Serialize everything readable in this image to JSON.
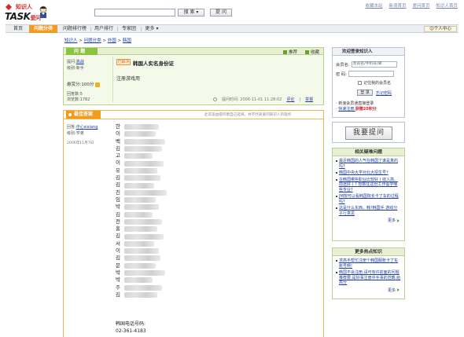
{
  "logo": {
    "top_text": "知识人",
    "main_text": "TASK",
    "sub_text": "爱问"
  },
  "top_links": [
    "收藏本站",
    "新浪首页",
    "爱问首页",
    "知识人首页"
  ],
  "search": {
    "button_label": "搜 索",
    "dropdown_icon": "chevron-down-icon",
    "ask_label": "提 问"
  },
  "nav": {
    "items": [
      "首页",
      "问题分类",
      "问题排行榜",
      "用户排行",
      "专家团",
      "更多"
    ],
    "active_index": 1,
    "user_center": "个人中心"
  },
  "breadcrumb": [
    "知识人",
    "问题分类",
    "外国",
    "韩国"
  ],
  "question": {
    "tab_label": "问 题",
    "actions": [
      "推荐",
      "收藏"
    ],
    "asker_label": "提问:",
    "asker_name": "高战",
    "level_label": "级别:",
    "level_value": "新手",
    "score_label": "悬赏分:",
    "score_value": "100分",
    "answers_label": "回答数:",
    "answers_value": "5",
    "views_label": "浏览数:",
    "views_value": "1782",
    "status_badge": "已解决",
    "title": "韩国人实名身份证",
    "description": "注册游戏用",
    "time_label": "提问时间:",
    "time_value": "2006-11-01 11:28:02",
    "comment_link": "评论",
    "report_link": "举报"
  },
  "note": "此答案由提问者自己选择，并不代表爱问知识人的观点",
  "best_answer": {
    "tab_label": "最佳答案",
    "answerer_label": "回答:",
    "answerer_name": "中心sixiang",
    "level_label": "级别:",
    "level_value": "学弟",
    "date": "2006年11月7日",
    "lines": [
      "한",
      "이",
      "백",
      "김",
      "고",
      "이",
      "유",
      "김",
      "김",
      "진",
      "임",
      "박",
      "김",
      "전",
      "홍",
      "김",
      "서",
      "이",
      "김",
      "문",
      "박",
      "박",
      "주",
      "김"
    ],
    "tail_lines": [
      "韩国电话号码:",
      "02-361-4183"
    ]
  },
  "login": {
    "title": "欢迎登录知识人",
    "member_label": "会员名:",
    "member_placeholder": "会员名/手机号/邮",
    "password_label": "密  码:",
    "remember_label": "记住我的会员名",
    "login_button": "登 录",
    "forgot_link": "忘记密码",
    "tip_1": "新浪会员通直接登录",
    "tip_2_link": "快速注册,",
    "tip_2_red": "获赠20积分"
  },
  "ask_big_label": "我要提问",
  "related": {
    "title": "相关疑难问题",
    "items": [
      "最近韩国的人气在韩国了谁是真的吗?",
      "韩国中央大学对北大招生号?",
      "在韩国哪些职业比较好 ( 收入高、前途好 ) ? 想数往这份工作需学哪些专业?",
      "JM按可以看韩国院长卡了车的过程吗?",
      "这是什么东西，韩?韩国手 游戏分子行意思"
    ],
    "more": "更多"
  },
  "hot": {
    "title": "更多热点知识",
    "items": [
      "求高手帮忙注册个韩国服账卡了车账号啊!",
      "韩国不会注册,请可有许前面的问题推荐要,是好事注册中手事的范畴,给高分"
    ],
    "more": "更多"
  }
}
